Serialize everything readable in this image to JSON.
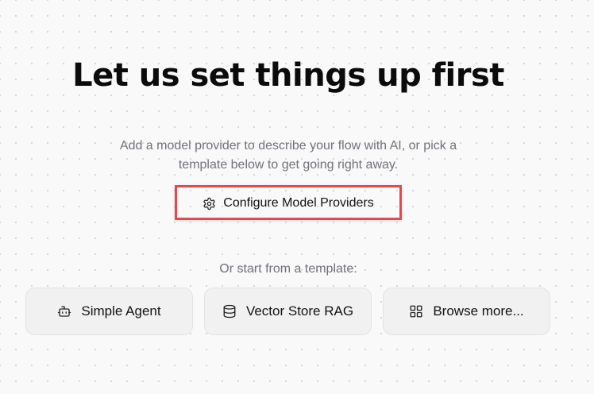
{
  "heading": "Let us set things up first",
  "description": {
    "line1": "Add a model provider to describe your flow with AI, or pick a",
    "line2": "template below to get going right away."
  },
  "configure_button": {
    "label": "Configure Model Providers",
    "icon": "gear-icon"
  },
  "templates_intro": "Or start from a template:",
  "templates": [
    {
      "label": "Simple Agent",
      "icon": "bot-icon"
    },
    {
      "label": "Vector Store RAG",
      "icon": "database-icon"
    },
    {
      "label": "Browse more...",
      "icon": "grid-icon"
    }
  ],
  "colors": {
    "highlight": "#e5484d",
    "muted_text": "#71717a",
    "card_background": "#f1f1f1"
  }
}
